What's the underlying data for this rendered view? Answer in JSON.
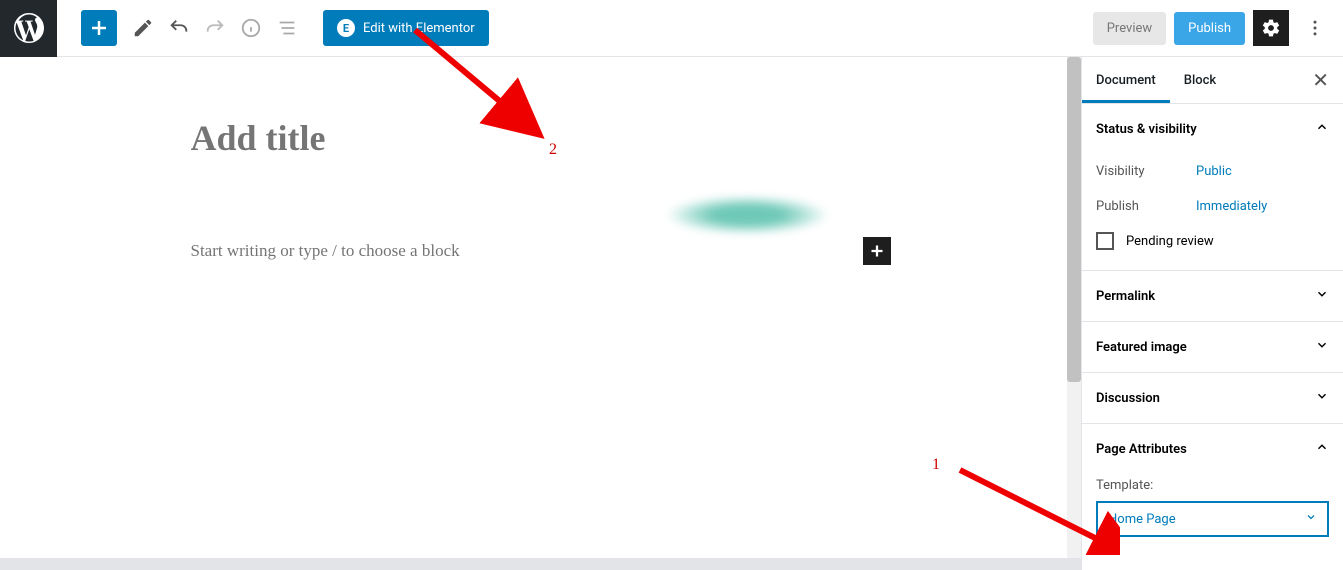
{
  "toolbar": {
    "elementor_label": "Edit with Elementor",
    "preview_label": "Preview",
    "publish_label": "Publish"
  },
  "editor": {
    "title_placeholder": "Add title",
    "body_placeholder": "Start writing or type / to choose a block"
  },
  "sidebar": {
    "tabs": {
      "document": "Document",
      "block": "Block"
    },
    "status": {
      "header": "Status & visibility",
      "visibility_label": "Visibility",
      "visibility_value": "Public",
      "publish_label": "Publish",
      "publish_value": "Immediately",
      "pending_label": "Pending review"
    },
    "permalink": "Permalink",
    "featured": "Featured image",
    "discussion": "Discussion",
    "attributes": {
      "header": "Page Attributes",
      "template_label": "Template:",
      "template_value": "Home Page"
    }
  },
  "annotations": {
    "num1": "1",
    "num2": "2"
  }
}
